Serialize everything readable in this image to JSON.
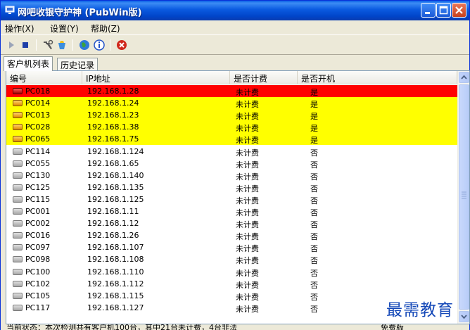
{
  "window": {
    "title": "网吧收银守护神 (PubWin版)"
  },
  "menu": {
    "items": [
      "操作(X)",
      "设置(Y)",
      "帮助(Z)"
    ]
  },
  "toolbar": {
    "icons": [
      "play-icon",
      "stop-icon",
      "tools-icon",
      "cleanup-icon",
      "globe-icon",
      "info-icon",
      "close-circle-icon"
    ]
  },
  "tabs": [
    "客户机列表",
    "历史记录"
  ],
  "table": {
    "columns": [
      "编号",
      "IP地址",
      "是否计费",
      "是否开机"
    ],
    "rows": [
      {
        "id": "PC018",
        "ip": "192.168.1.28",
        "billing": "未计费",
        "powered": "是",
        "status": "red"
      },
      {
        "id": "PC014",
        "ip": "192.168.1.24",
        "billing": "未计费",
        "powered": "是",
        "status": "yellow"
      },
      {
        "id": "PC013",
        "ip": "192.168.1.23",
        "billing": "未计费",
        "powered": "是",
        "status": "yellow"
      },
      {
        "id": "PC028",
        "ip": "192.168.1.38",
        "billing": "未计费",
        "powered": "是",
        "status": "yellow"
      },
      {
        "id": "PC065",
        "ip": "192.168.1.75",
        "billing": "未计费",
        "powered": "是",
        "status": "yellow"
      },
      {
        "id": "PC114",
        "ip": "192.168.1.124",
        "billing": "未计费",
        "powered": "否",
        "status": "off"
      },
      {
        "id": "PC055",
        "ip": "192.168.1.65",
        "billing": "未计费",
        "powered": "否",
        "status": "off"
      },
      {
        "id": "PC130",
        "ip": "192.168.1.140",
        "billing": "未计费",
        "powered": "否",
        "status": "off"
      },
      {
        "id": "PC125",
        "ip": "192.168.1.135",
        "billing": "未计费",
        "powered": "否",
        "status": "off"
      },
      {
        "id": "PC115",
        "ip": "192.168.1.125",
        "billing": "未计费",
        "powered": "否",
        "status": "off"
      },
      {
        "id": "PC001",
        "ip": "192.168.1.11",
        "billing": "未计费",
        "powered": "否",
        "status": "off"
      },
      {
        "id": "PC002",
        "ip": "192.168.1.12",
        "billing": "未计费",
        "powered": "否",
        "status": "off"
      },
      {
        "id": "PC016",
        "ip": "192.168.1.26",
        "billing": "未计费",
        "powered": "否",
        "status": "off"
      },
      {
        "id": "PC097",
        "ip": "192.168.1.107",
        "billing": "未计费",
        "powered": "否",
        "status": "off"
      },
      {
        "id": "PC098",
        "ip": "192.168.1.108",
        "billing": "未计费",
        "powered": "否",
        "status": "off"
      },
      {
        "id": "PC100",
        "ip": "192.168.1.110",
        "billing": "未计费",
        "powered": "否",
        "status": "off"
      },
      {
        "id": "PC102",
        "ip": "192.168.1.112",
        "billing": "未计费",
        "powered": "否",
        "status": "off"
      },
      {
        "id": "PC105",
        "ip": "192.168.1.115",
        "billing": "未计费",
        "powered": "否",
        "status": "off"
      },
      {
        "id": "PC117",
        "ip": "192.168.1.127",
        "billing": "未计费",
        "powered": "否",
        "status": "off"
      }
    ]
  },
  "status": {
    "text": "当前状态：本次检测共有客户机100台，其中21台未计费，4台非法",
    "right": "免费版"
  },
  "watermark": "最需教育",
  "colors": {
    "alert_row": "#ff0000",
    "warning_row": "#ffff00",
    "titlebar": "#0a5ae0"
  }
}
